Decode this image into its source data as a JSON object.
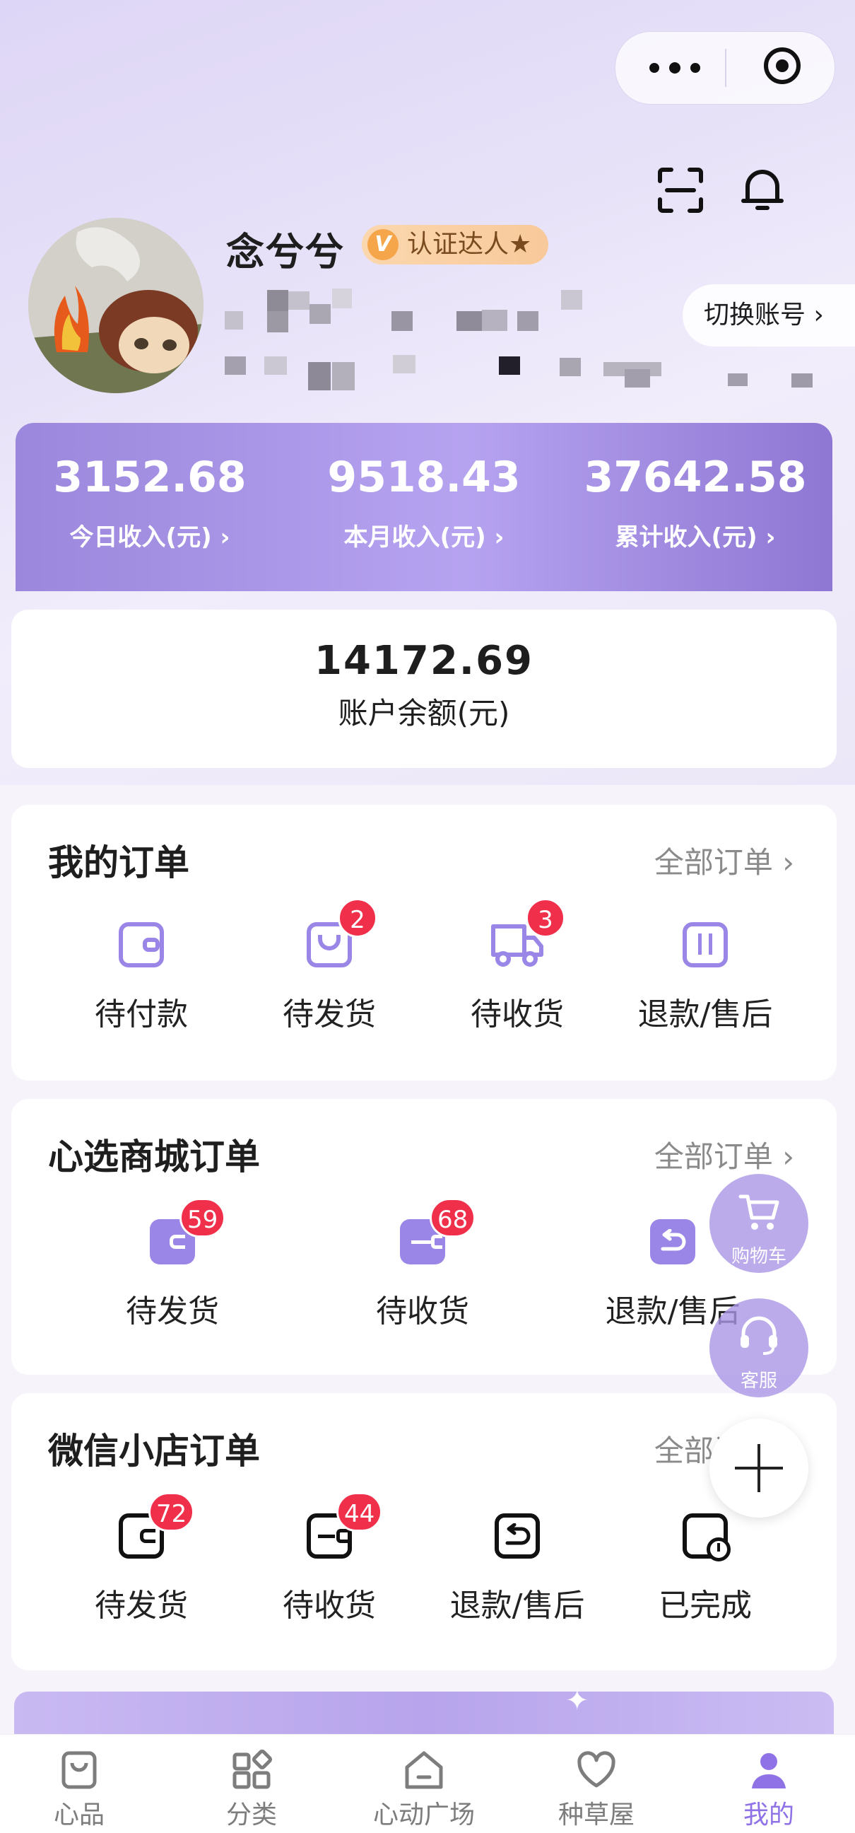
{
  "profile": {
    "name": "念兮兮",
    "badge": "认证达人★",
    "badge_icon": "V",
    "switch_account": "切换账号 ›"
  },
  "income": {
    "today": {
      "value": "3152.68",
      "label": "今日收入(元) ›"
    },
    "month": {
      "value": "9518.43",
      "label": "本月收入(元) ›"
    },
    "total": {
      "value": "37642.58",
      "label": "累计收入(元) ›"
    }
  },
  "balance": {
    "value": "14172.69",
    "label": "账户余额(元)"
  },
  "my_orders": {
    "title": "我的订单",
    "all": "全部订单 ›",
    "items": [
      {
        "label": "待付款",
        "badge": ""
      },
      {
        "label": "待发货",
        "badge": "2"
      },
      {
        "label": "待收货",
        "badge": "3"
      },
      {
        "label": "退款/售后",
        "badge": ""
      }
    ]
  },
  "mall_orders": {
    "title": "心选商城订单",
    "all": "全部订单 ›",
    "items": [
      {
        "label": "待发货",
        "badge": "59"
      },
      {
        "label": "待收货",
        "badge": "68"
      },
      {
        "label": "退款/售后",
        "badge": ""
      }
    ]
  },
  "wx_orders": {
    "title": "微信小店订单",
    "all": "全部订单 ›",
    "items": [
      {
        "label": "待发货",
        "badge": "72"
      },
      {
        "label": "待收货",
        "badge": "44"
      },
      {
        "label": "退款/售后",
        "badge": ""
      },
      {
        "label": "已完成",
        "badge": ""
      }
    ]
  },
  "floating": {
    "cart": "购物车",
    "service": "客服"
  },
  "tabs": [
    {
      "label": "心品",
      "icon": "bag-icon"
    },
    {
      "label": "分类",
      "icon": "grid-icon"
    },
    {
      "label": "心动广场",
      "icon": "home-icon"
    },
    {
      "label": "种草屋",
      "icon": "heart-icon"
    },
    {
      "label": "我的",
      "icon": "person-icon"
    }
  ],
  "colors": {
    "accent": "#9a86e6",
    "badge": "#f0304b",
    "active_tab": "#8e72e6"
  }
}
